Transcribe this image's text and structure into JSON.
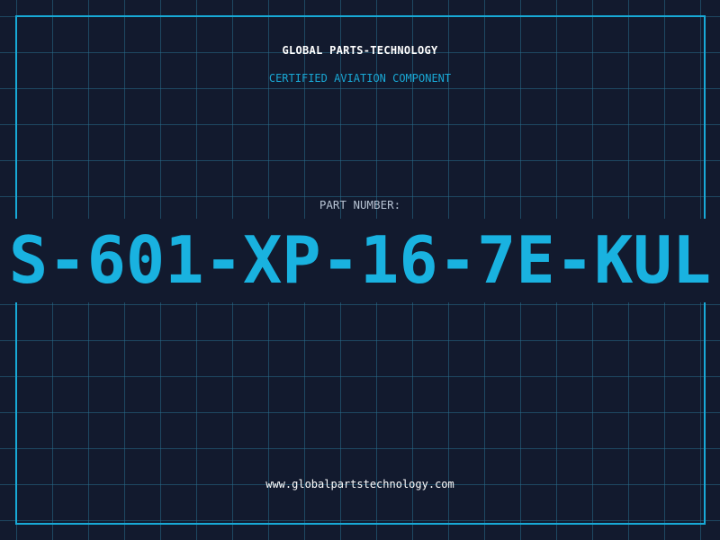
{
  "label": {
    "company": "GLOBAL PARTS-TECHNOLOGY",
    "subtitle": "CERTIFIED AVIATION COMPONENT",
    "part_number_label": "PART NUMBER:",
    "part_number": "S-601-XP-16-7E-KUL",
    "website": "www.globalpartstechnology.com"
  },
  "colors": {
    "background": "#121a2e",
    "grid": "#286e8c",
    "accent": "#19b2e0",
    "text": "#ffffff",
    "muted_text": "#b7c3d3"
  }
}
